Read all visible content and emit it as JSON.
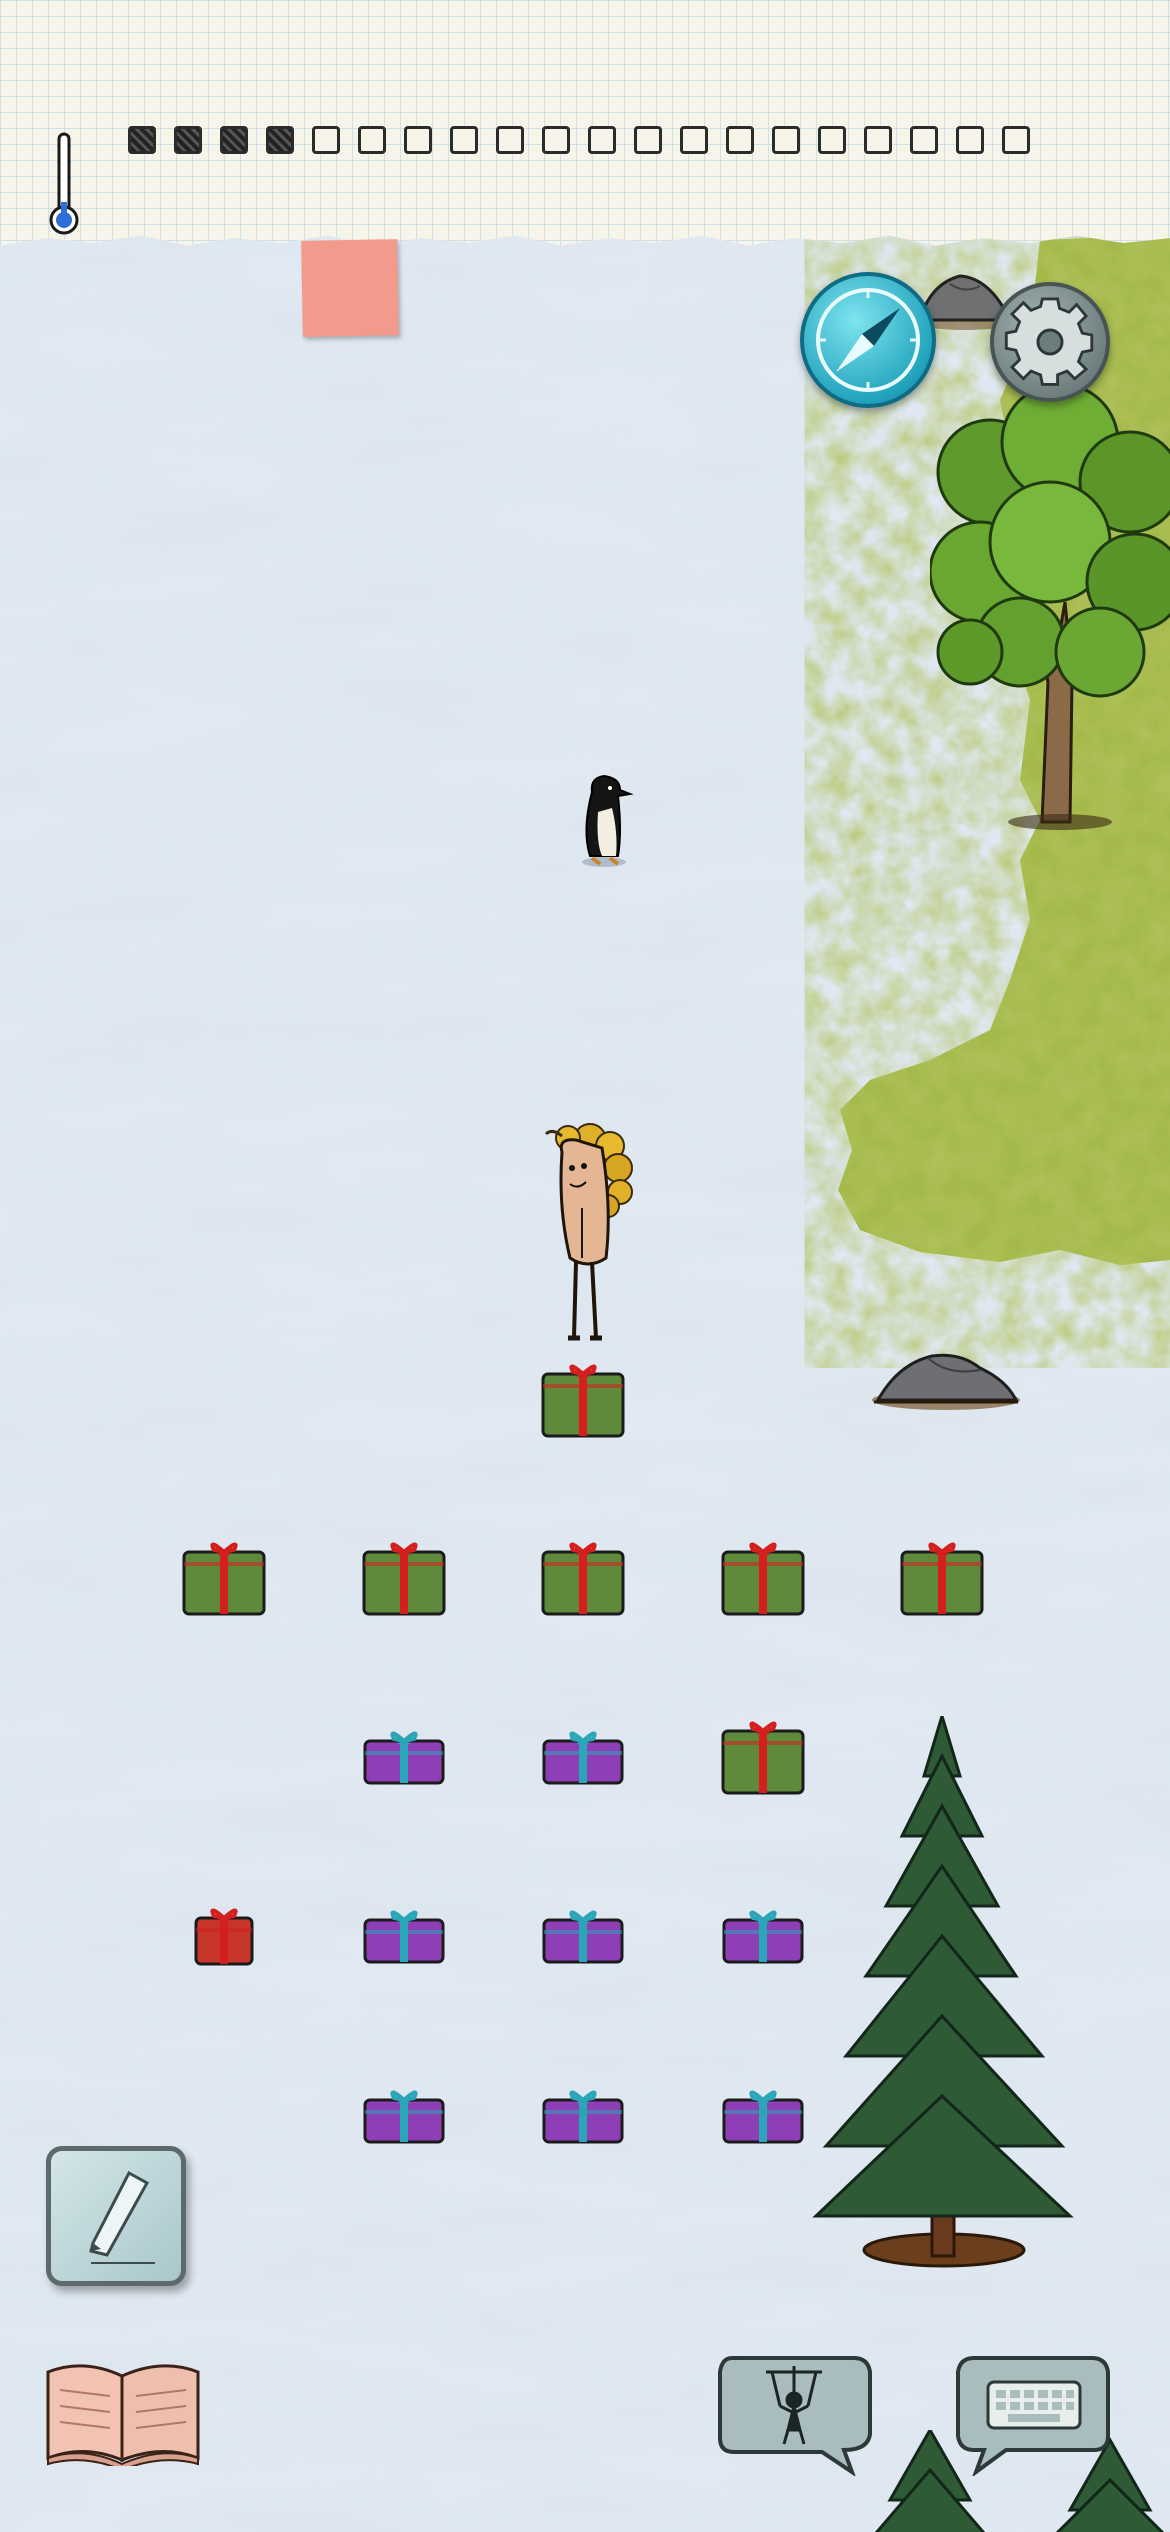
{
  "hud": {
    "thermometer": {
      "icon": "thermometer-icon",
      "fill_color": "#2d6fd6"
    },
    "progress": {
      "total": 20,
      "completed": 4
    }
  },
  "buttons": {
    "compass": {
      "icon": "compass-icon"
    },
    "settings": {
      "icon": "gear-icon"
    },
    "edit": {
      "icon": "pencil-icon"
    },
    "journal": {
      "icon": "open-book-icon"
    },
    "puppet": {
      "icon": "puppet-icon"
    },
    "keyboard": {
      "icon": "keyboard-icon"
    }
  },
  "colors": {
    "snow": "#d7e2ec",
    "grass": "#9fb53f",
    "gift_green": "#5f8a3c",
    "gift_purple": "#8f3fb5",
    "gift_red": "#c8352b",
    "ribbon_red": "#d41f1f",
    "ribbon_teal": "#2aa6b8"
  },
  "gifts": [
    {
      "col": 2,
      "row": 0,
      "color": "green",
      "size": "large"
    },
    {
      "col": 0,
      "row": 1,
      "color": "green",
      "size": "large"
    },
    {
      "col": 1,
      "row": 1,
      "color": "green",
      "size": "large"
    },
    {
      "col": 2,
      "row": 1,
      "color": "green",
      "size": "large"
    },
    {
      "col": 3,
      "row": 1,
      "color": "green",
      "size": "large"
    },
    {
      "col": 4,
      "row": 1,
      "color": "green",
      "size": "large"
    },
    {
      "col": 1,
      "row": 2,
      "color": "purple",
      "size": "flat"
    },
    {
      "col": 2,
      "row": 2,
      "color": "purple",
      "size": "flat"
    },
    {
      "col": 3,
      "row": 2,
      "color": "green",
      "size": "large"
    },
    {
      "col": 0,
      "row": 3,
      "color": "red",
      "size": "small"
    },
    {
      "col": 1,
      "row": 3,
      "color": "purple",
      "size": "flat"
    },
    {
      "col": 2,
      "row": 3,
      "color": "purple",
      "size": "flat"
    },
    {
      "col": 3,
      "row": 3,
      "color": "purple",
      "size": "flat"
    },
    {
      "col": 1,
      "row": 4,
      "color": "purple",
      "size": "flat"
    },
    {
      "col": 2,
      "row": 4,
      "color": "purple",
      "size": "flat"
    },
    {
      "col": 3,
      "row": 4,
      "color": "purple",
      "size": "flat"
    }
  ]
}
